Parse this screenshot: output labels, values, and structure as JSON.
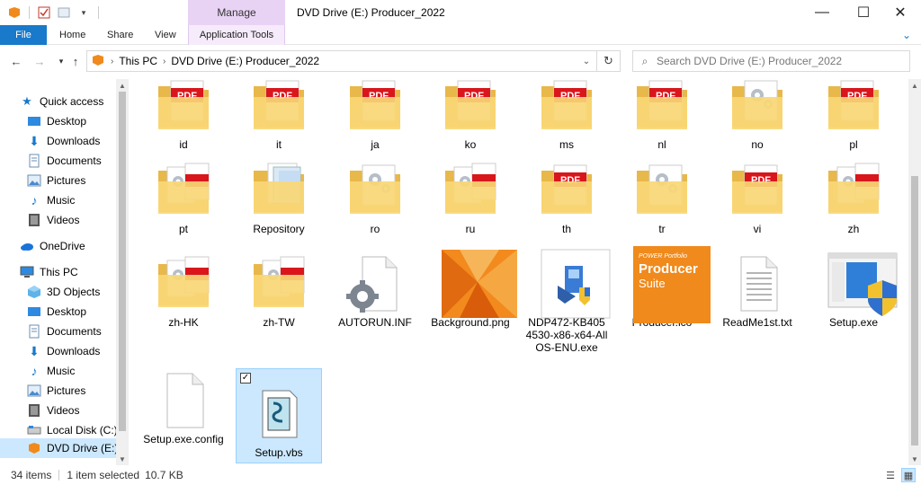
{
  "window": {
    "title": "DVD Drive (E:) Producer_2022",
    "manage_tab": "Manage",
    "controls": [
      "—",
      "☐",
      "✕"
    ]
  },
  "ribbon": {
    "tabs": [
      "File",
      "Home",
      "Share",
      "View"
    ],
    "app_tools": "Application Tools"
  },
  "address": {
    "segments": [
      "This PC",
      "DVD Drive (E:) Producer_2022"
    ],
    "search_placeholder": "Search DVD Drive (E:) Producer_2022"
  },
  "nav": {
    "quick_access": "Quick access",
    "quick_items": [
      {
        "label": "Desktop",
        "icon": "desktop-icon"
      },
      {
        "label": "Downloads",
        "icon": "downloads-icon"
      },
      {
        "label": "Documents",
        "icon": "documents-icon"
      },
      {
        "label": "Pictures",
        "icon": "pictures-icon"
      },
      {
        "label": "Music",
        "icon": "music-icon"
      },
      {
        "label": "Videos",
        "icon": "videos-icon"
      }
    ],
    "onedrive": "OneDrive",
    "this_pc": "This PC",
    "pc_items": [
      {
        "label": "3D Objects",
        "icon": "3d-objects-icon"
      },
      {
        "label": "Desktop",
        "icon": "desktop-icon"
      },
      {
        "label": "Documents",
        "icon": "documents-icon"
      },
      {
        "label": "Downloads",
        "icon": "downloads-icon"
      },
      {
        "label": "Music",
        "icon": "music-icon"
      },
      {
        "label": "Pictures",
        "icon": "pictures-icon"
      },
      {
        "label": "Videos",
        "icon": "videos-icon"
      },
      {
        "label": "Local Disk (C:)",
        "icon": "local-disk-icon"
      },
      {
        "label": "DVD Drive (E:) Pr",
        "icon": "dvd-drive-icon"
      }
    ]
  },
  "files": [
    {
      "label": "id",
      "icon": "folder-pdf-icon"
    },
    {
      "label": "it",
      "icon": "folder-pdf-icon"
    },
    {
      "label": "ja",
      "icon": "folder-pdf-icon"
    },
    {
      "label": "ko",
      "icon": "folder-pdf-icon"
    },
    {
      "label": "ms",
      "icon": "folder-pdf-icon"
    },
    {
      "label": "nl",
      "icon": "folder-pdf-icon"
    },
    {
      "label": "no",
      "icon": "folder-gear-icon"
    },
    {
      "label": "pl",
      "icon": "folder-pdf-icon"
    },
    {
      "label": "pt",
      "icon": "folder-gear-pdf-icon"
    },
    {
      "label": "Repository",
      "icon": "folder-docs-icon"
    },
    {
      "label": "ro",
      "icon": "folder-gear-icon"
    },
    {
      "label": "ru",
      "icon": "folder-gear-pdf-icon"
    },
    {
      "label": "th",
      "icon": "folder-pdf-icon"
    },
    {
      "label": "tr",
      "icon": "folder-gear-icon"
    },
    {
      "label": "vi",
      "icon": "folder-pdf-icon"
    },
    {
      "label": "zh",
      "icon": "folder-gear-pdf-icon"
    },
    {
      "label": "zh-HK",
      "icon": "folder-gear-pdf-icon"
    },
    {
      "label": "zh-TW",
      "icon": "folder-gear-pdf-icon"
    },
    {
      "label": "AUTORUN.INF",
      "icon": "inf-gear-icon"
    },
    {
      "label": "Background.png",
      "icon": "png-image-icon"
    },
    {
      "label": "NDP472-KB4054530-x86-x64-AllOS-ENU.exe",
      "icon": "installer-exe-icon"
    },
    {
      "label": "Producer.ico",
      "icon": "producer-ico-icon"
    },
    {
      "label": "ReadMe1st.txt",
      "icon": "text-file-icon"
    },
    {
      "label": "Setup.exe",
      "icon": "setup-exe-icon"
    },
    {
      "label": "Setup.exe.config",
      "icon": "blank-file-icon"
    },
    {
      "label": "Setup.vbs",
      "icon": "vbs-script-icon",
      "selected": true
    }
  ],
  "producer_icon_text": {
    "line1": "POWER Portfolio",
    "line2": "Producer",
    "line3": "Suite"
  },
  "status": {
    "items": "34 items",
    "selected": "1 item selected",
    "size": "10.7 KB"
  },
  "colors": {
    "accent": "#1979ca",
    "selection": "#cce8ff",
    "manage": "#e9d3f5",
    "folder": "#f8d775",
    "pdf_red": "#d9161c"
  }
}
